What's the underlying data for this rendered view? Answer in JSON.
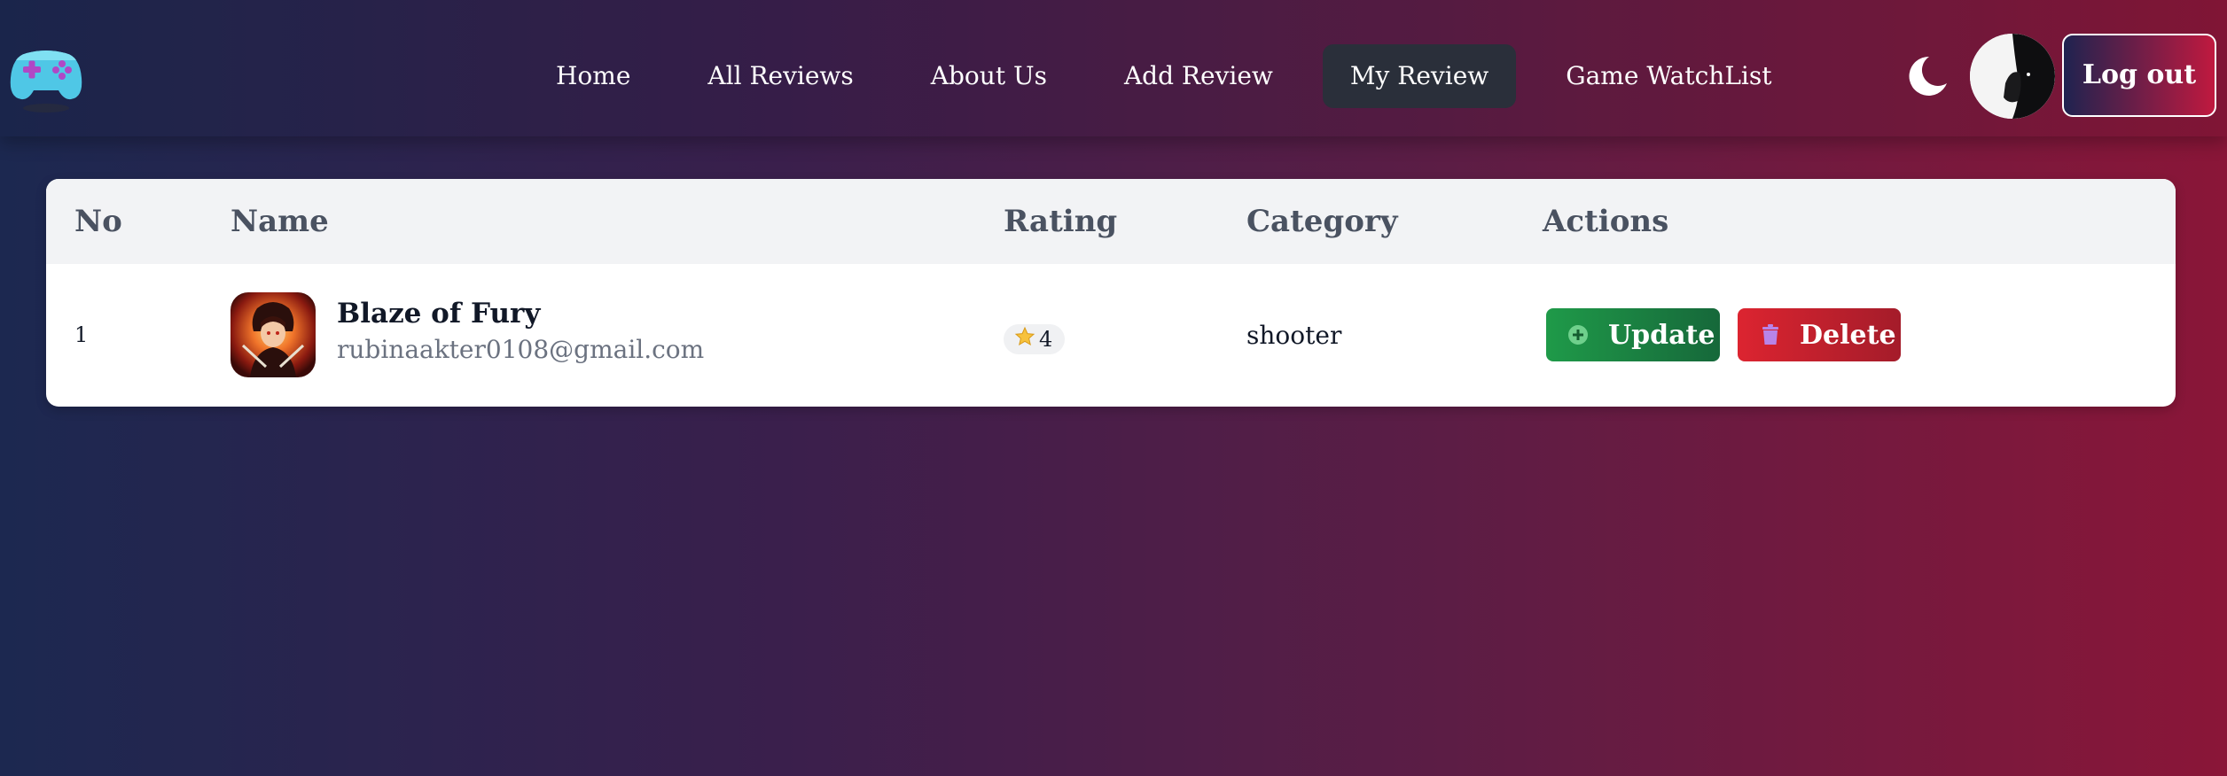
{
  "navbar": {
    "links": [
      {
        "label": "Home"
      },
      {
        "label": "All Reviews"
      },
      {
        "label": "About Us"
      },
      {
        "label": "Add Review"
      },
      {
        "label": "My Review",
        "active": true
      },
      {
        "label": "Game WatchList"
      }
    ],
    "logout_label": "Log out",
    "logo_icon": "gamepad-icon",
    "theme_icon": "moon-icon"
  },
  "table": {
    "headers": {
      "no": "No",
      "name": "Name",
      "rating": "Rating",
      "category": "Category",
      "actions": "Actions"
    },
    "rows": [
      {
        "no": "1",
        "name": "Blaze of Fury",
        "email": "rubinaakter0108@gmail.com",
        "rating": "4",
        "category": "shooter",
        "update_label": "Update",
        "delete_label": "Delete"
      }
    ]
  },
  "colors": {
    "update": "#1f9a49",
    "delete": "#dc2430",
    "active_nav": "#2a2f3a"
  }
}
